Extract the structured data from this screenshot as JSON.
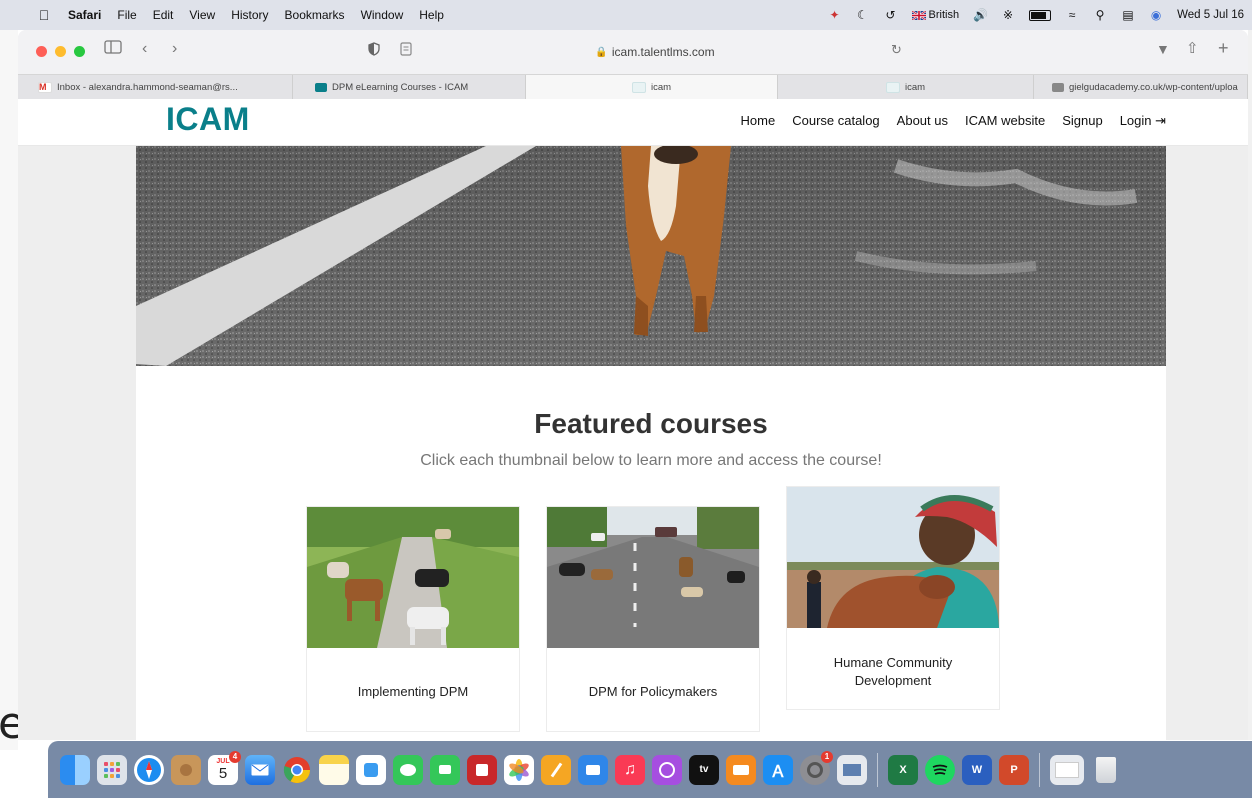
{
  "menubar": {
    "items": [
      "Safari",
      "File",
      "Edit",
      "View",
      "History",
      "Bookmarks",
      "Window",
      "Help"
    ],
    "language": "British",
    "datetime": "Wed 5 Jul 16"
  },
  "browser": {
    "url": "icam.talentlms.com",
    "tabs": [
      {
        "label": "Inbox - alexandra.hammond-seaman@rs..."
      },
      {
        "label": "DPM eLearning Courses - ICAM"
      },
      {
        "label": "icam"
      },
      {
        "label": "icam"
      },
      {
        "label": "gielgudacademy.co.uk/wp-content/uploa"
      }
    ]
  },
  "site": {
    "logo": "ICAM",
    "nav": [
      "Home",
      "Course catalog",
      "About us",
      "ICAM website",
      "Signup",
      "Login ⇥"
    ],
    "featured_title": "Featured courses",
    "featured_subtitle": "Click each thumbnail below to learn more and access the course!",
    "courses": [
      {
        "title": "Implementing DPM"
      },
      {
        "title": "DPM for Policymakers"
      },
      {
        "title": "Humane Community Development"
      }
    ]
  },
  "desktop": {
    "fragment_text": "e"
  },
  "dock": {
    "calendar": {
      "month": "JUL",
      "day": "5"
    },
    "badges": {
      "calendar": "4",
      "settings": "1"
    }
  }
}
